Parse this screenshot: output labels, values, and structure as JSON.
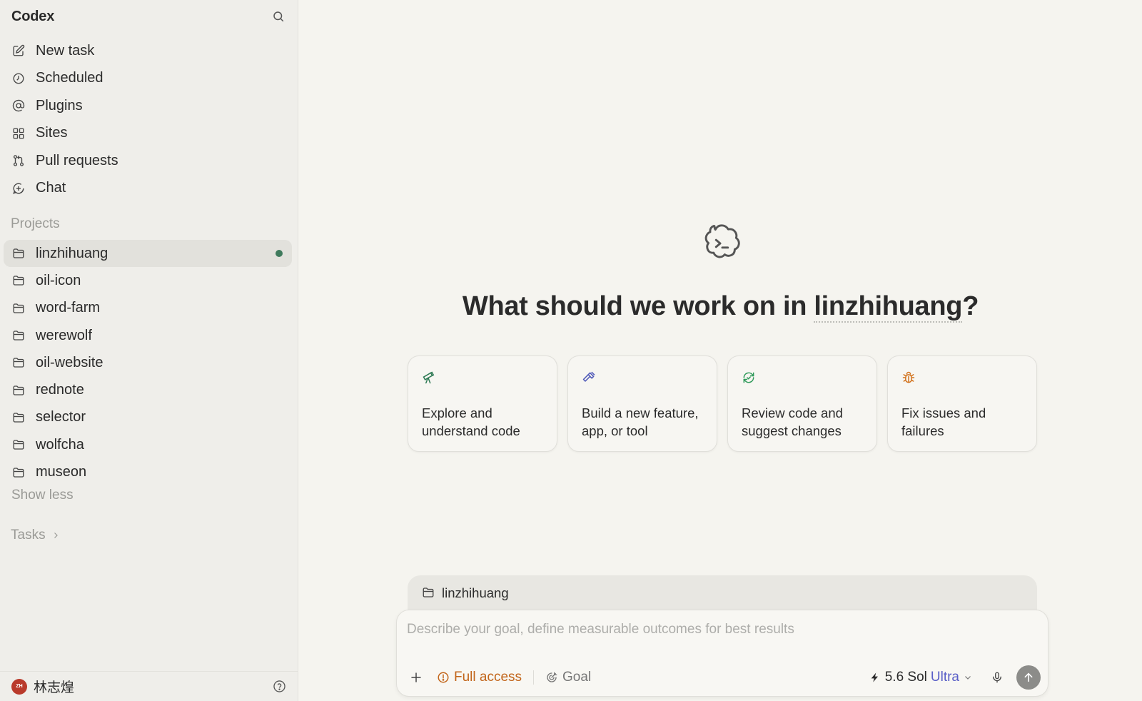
{
  "app": {
    "title": "Codex"
  },
  "nav": {
    "items": [
      {
        "label": "New task",
        "icon": "edit-icon"
      },
      {
        "label": "Scheduled",
        "icon": "clock-icon"
      },
      {
        "label": "Plugins",
        "icon": "at-sign-icon"
      },
      {
        "label": "Sites",
        "icon": "grid-icon"
      },
      {
        "label": "Pull requests",
        "icon": "pull-request-icon"
      },
      {
        "label": "Chat",
        "icon": "chat-plus-icon"
      }
    ]
  },
  "projects": {
    "label": "Projects",
    "items": [
      {
        "label": "linzhihuang",
        "active": true
      },
      {
        "label": "oil-icon"
      },
      {
        "label": "word-farm"
      },
      {
        "label": "werewolf"
      },
      {
        "label": "oil-website"
      },
      {
        "label": "rednote"
      },
      {
        "label": "selector"
      },
      {
        "label": "wolfcha"
      },
      {
        "label": "museon"
      }
    ],
    "show_less": "Show less"
  },
  "tasks": {
    "label": "Tasks"
  },
  "user": {
    "initials": "ZH",
    "name": "林志煌",
    "avatar_color": "#b93a2b"
  },
  "main": {
    "headline_prefix": "What should we work on in ",
    "headline_project": "linzhihuang",
    "headline_suffix": "?",
    "cards": [
      {
        "text": "Explore and understand code",
        "icon": "telescope-icon",
        "color": "#2f7a55"
      },
      {
        "text": "Build a new feature, app, or tool",
        "icon": "hammer-icon",
        "color": "#4f58b8"
      },
      {
        "text": "Review code and suggest changes",
        "icon": "refresh-icon",
        "color": "#2f9a5a"
      },
      {
        "text": "Fix issues and failures",
        "icon": "bug-icon",
        "color": "#d2721c"
      }
    ]
  },
  "composer": {
    "context_project": "linzhihuang",
    "placeholder": "Describe your goal, define measurable outcomes for best results",
    "value": "",
    "access": "Full access",
    "goal": "Goal",
    "model": "5.6 Sol",
    "model_variant": "Ultra",
    "colors": {
      "access": "#c2651a",
      "variant": "#5a5fc7"
    }
  }
}
